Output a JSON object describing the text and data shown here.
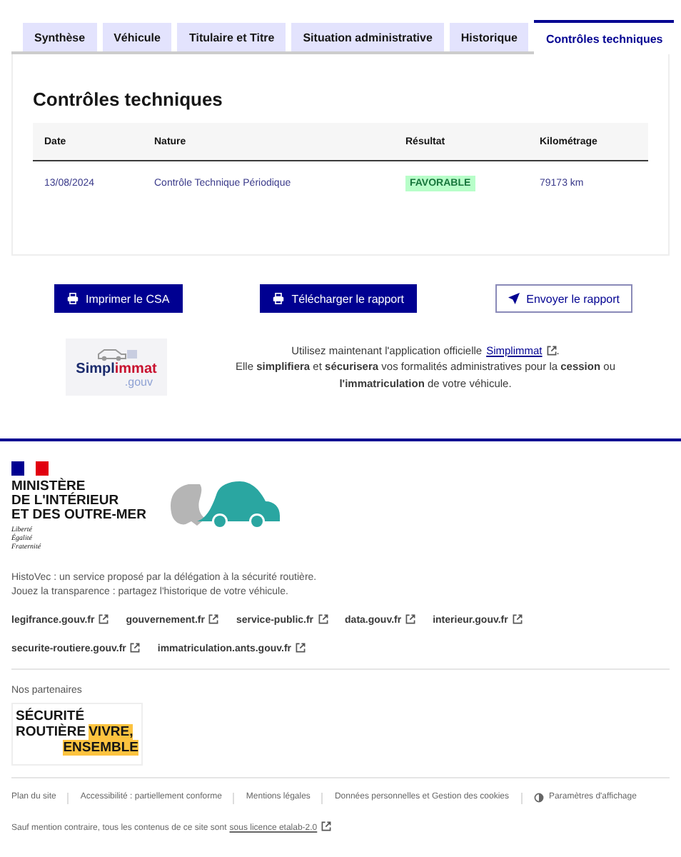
{
  "tabs": [
    {
      "label": "Synthèse",
      "selected": false
    },
    {
      "label": "Véhicule",
      "selected": false
    },
    {
      "label": "Titulaire et Titre",
      "selected": false
    },
    {
      "label": "Situation administrative",
      "selected": false
    },
    {
      "label": "Historique",
      "selected": false
    },
    {
      "label": "Contrôles techniques",
      "selected": true
    }
  ],
  "section": {
    "title": "Contrôles techniques",
    "table": {
      "columns": [
        "Date",
        "Nature",
        "Résultat",
        "Kilométrage"
      ],
      "rows": [
        {
          "date": "13/08/2024",
          "nature": "Contrôle Technique Périodique",
          "result": {
            "label": "FAVORABLE",
            "kind": "success"
          },
          "mileage": "79173 km"
        }
      ]
    }
  },
  "actions": [
    {
      "label": "Imprimer le CSA",
      "kind": "primary"
    },
    {
      "label": "Télécharger le rapport",
      "kind": "primary"
    },
    {
      "label": "Envoyer le rapport",
      "kind": "secondary"
    }
  ],
  "app_promo": {
    "logo": {
      "first": "Simpl",
      "second": "immat",
      "suffix": ".gouv"
    },
    "intro": "Utilisez maintenant l'application officielle",
    "link": "Simplimmat",
    "after": ".",
    "text": "Elle **simplifiera** et **sécurisera** vos formalités administratives pour la **cession** ou **l'immatriculation** de votre véhicule."
  },
  "footer": {
    "ministry": {
      "name": [
        "MINISTÈRE",
        "DE L'INTÉRIEUR",
        "ET DES OUTRE-MER"
      ],
      "motto": [
        "Liberté",
        "Égalité",
        "Fraternité"
      ]
    },
    "description": [
      "HistoVec : un service proposé par la délégation à la sécurité routière.",
      "Jouez la transparence : partagez l'historique de votre véhicule."
    ],
    "links": [
      [
        "legifrance.gouv.fr",
        "gouvernement.fr",
        "service-public.fr",
        "data.gouv.fr",
        "interieur.gouv.fr"
      ],
      [
        "securite-routiere.gouv.fr",
        "immatriculation.ants.gouv.fr"
      ]
    ],
    "partners_title": "Nos partenaires",
    "partner_logo": [
      [
        {
          "text": "SÉCURITÉ",
          "highlight": false
        }
      ],
      [
        {
          "text": "ROUTIÈRE",
          "highlight": false
        },
        {
          "text": "VIVRE,",
          "highlight": true
        }
      ],
      [
        {
          "text": "ENSEMBLE",
          "highlight": true
        }
      ]
    ],
    "bottom_links": [
      {
        "label": "Plan du site",
        "kind": "link"
      },
      {
        "label": "Accessibilité : partiellement conforme",
        "kind": "link"
      },
      {
        "label": "Mentions légales",
        "kind": "link"
      },
      {
        "label": "Données personnelles et Gestion des cookies",
        "kind": "link"
      },
      {
        "label": "Paramètres d'affichage",
        "kind": "display"
      }
    ],
    "license": {
      "text": "Sauf mention contraire, tous les contenus de ce site sont",
      "link": "sous licence etalab-2.0"
    }
  }
}
